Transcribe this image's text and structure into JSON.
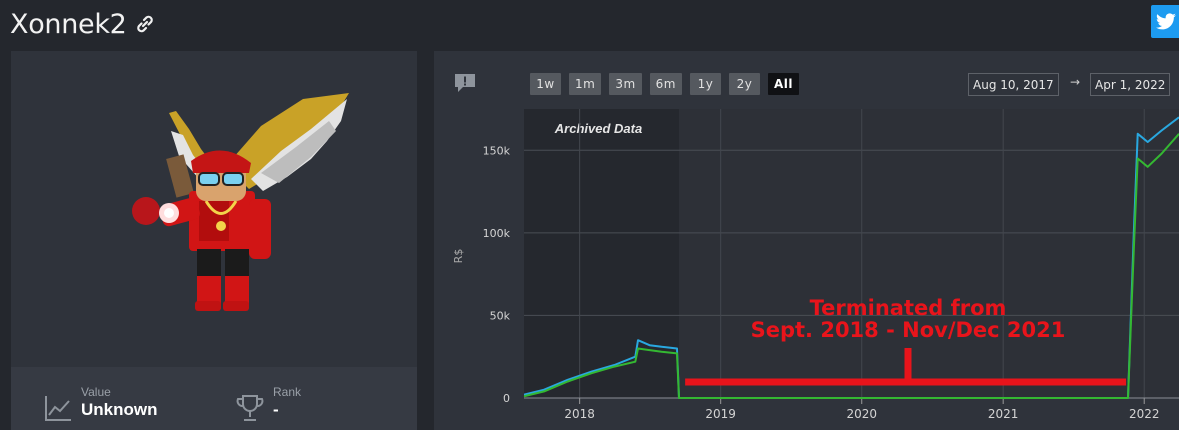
{
  "profile": {
    "username": "Xonnek2",
    "link_icon": "link-icon",
    "share_icon": "twitter-icon"
  },
  "stats": {
    "value_label": "Value",
    "value": "Unknown",
    "rank_label": "Rank",
    "rank": "-"
  },
  "chart_controls": {
    "ranges": [
      "1w",
      "1m",
      "3m",
      "6m",
      "1y",
      "2y",
      "All"
    ],
    "active_range": "All",
    "from_date": "Aug 10, 2017",
    "to_date": "Apr 1, 2022",
    "arrow": "→"
  },
  "annotation": {
    "line1": "Terminated from",
    "line2": "Sept. 2018 - Nov/Dec 2021",
    "color": "#e8141b"
  },
  "chart_data": {
    "type": "line",
    "title": "",
    "xlabel": "",
    "ylabel": "R$",
    "x_ticks": [
      "2018",
      "2019",
      "2020",
      "2021",
      "2022"
    ],
    "y_ticks": [
      "0",
      "50k",
      "100k",
      "150k"
    ],
    "ylim": [
      0,
      175000
    ],
    "xlim": [
      "2017-08-10",
      "2022-04-01"
    ],
    "shaded_region": {
      "label": "Archived Data",
      "from": "2017-08-10",
      "to": "2018-09-15"
    },
    "grid": true,
    "series": [
      {
        "color": "#29a8e0",
        "points": [
          [
            "2017-08-10",
            2000
          ],
          [
            "2017-10-01",
            5000
          ],
          [
            "2017-12-01",
            11000
          ],
          [
            "2018-02-01",
            16000
          ],
          [
            "2018-04-01",
            20000
          ],
          [
            "2018-05-25",
            25000
          ],
          [
            "2018-06-01",
            35000
          ],
          [
            "2018-07-01",
            32000
          ],
          [
            "2018-08-01",
            31000
          ],
          [
            "2018-09-10",
            30000
          ],
          [
            "2018-09-15",
            0
          ],
          [
            "2021-11-20",
            0
          ],
          [
            "2021-12-05",
            100000
          ],
          [
            "2021-12-15",
            160000
          ],
          [
            "2022-01-10",
            155000
          ],
          [
            "2022-02-15",
            162000
          ],
          [
            "2022-04-01",
            170000
          ]
        ]
      },
      {
        "color": "#34b832",
        "points": [
          [
            "2017-08-10",
            1000
          ],
          [
            "2017-10-01",
            4000
          ],
          [
            "2017-12-01",
            10000
          ],
          [
            "2018-02-01",
            15000
          ],
          [
            "2018-04-01",
            19000
          ],
          [
            "2018-05-25",
            22000
          ],
          [
            "2018-06-01",
            30000
          ],
          [
            "2018-07-01",
            29000
          ],
          [
            "2018-08-01",
            28000
          ],
          [
            "2018-09-10",
            27000
          ],
          [
            "2018-09-15",
            0
          ],
          [
            "2021-11-20",
            0
          ],
          [
            "2021-12-05",
            90000
          ],
          [
            "2021-12-15",
            145000
          ],
          [
            "2022-01-10",
            140000
          ],
          [
            "2022-02-15",
            148000
          ],
          [
            "2022-04-01",
            160000
          ]
        ]
      }
    ]
  },
  "colors": {
    "background": "#24272d",
    "card": "#2f333b",
    "plot_bg": "#2d3037",
    "archived_bg": "#25282e",
    "accent": "#1d9bf0"
  }
}
